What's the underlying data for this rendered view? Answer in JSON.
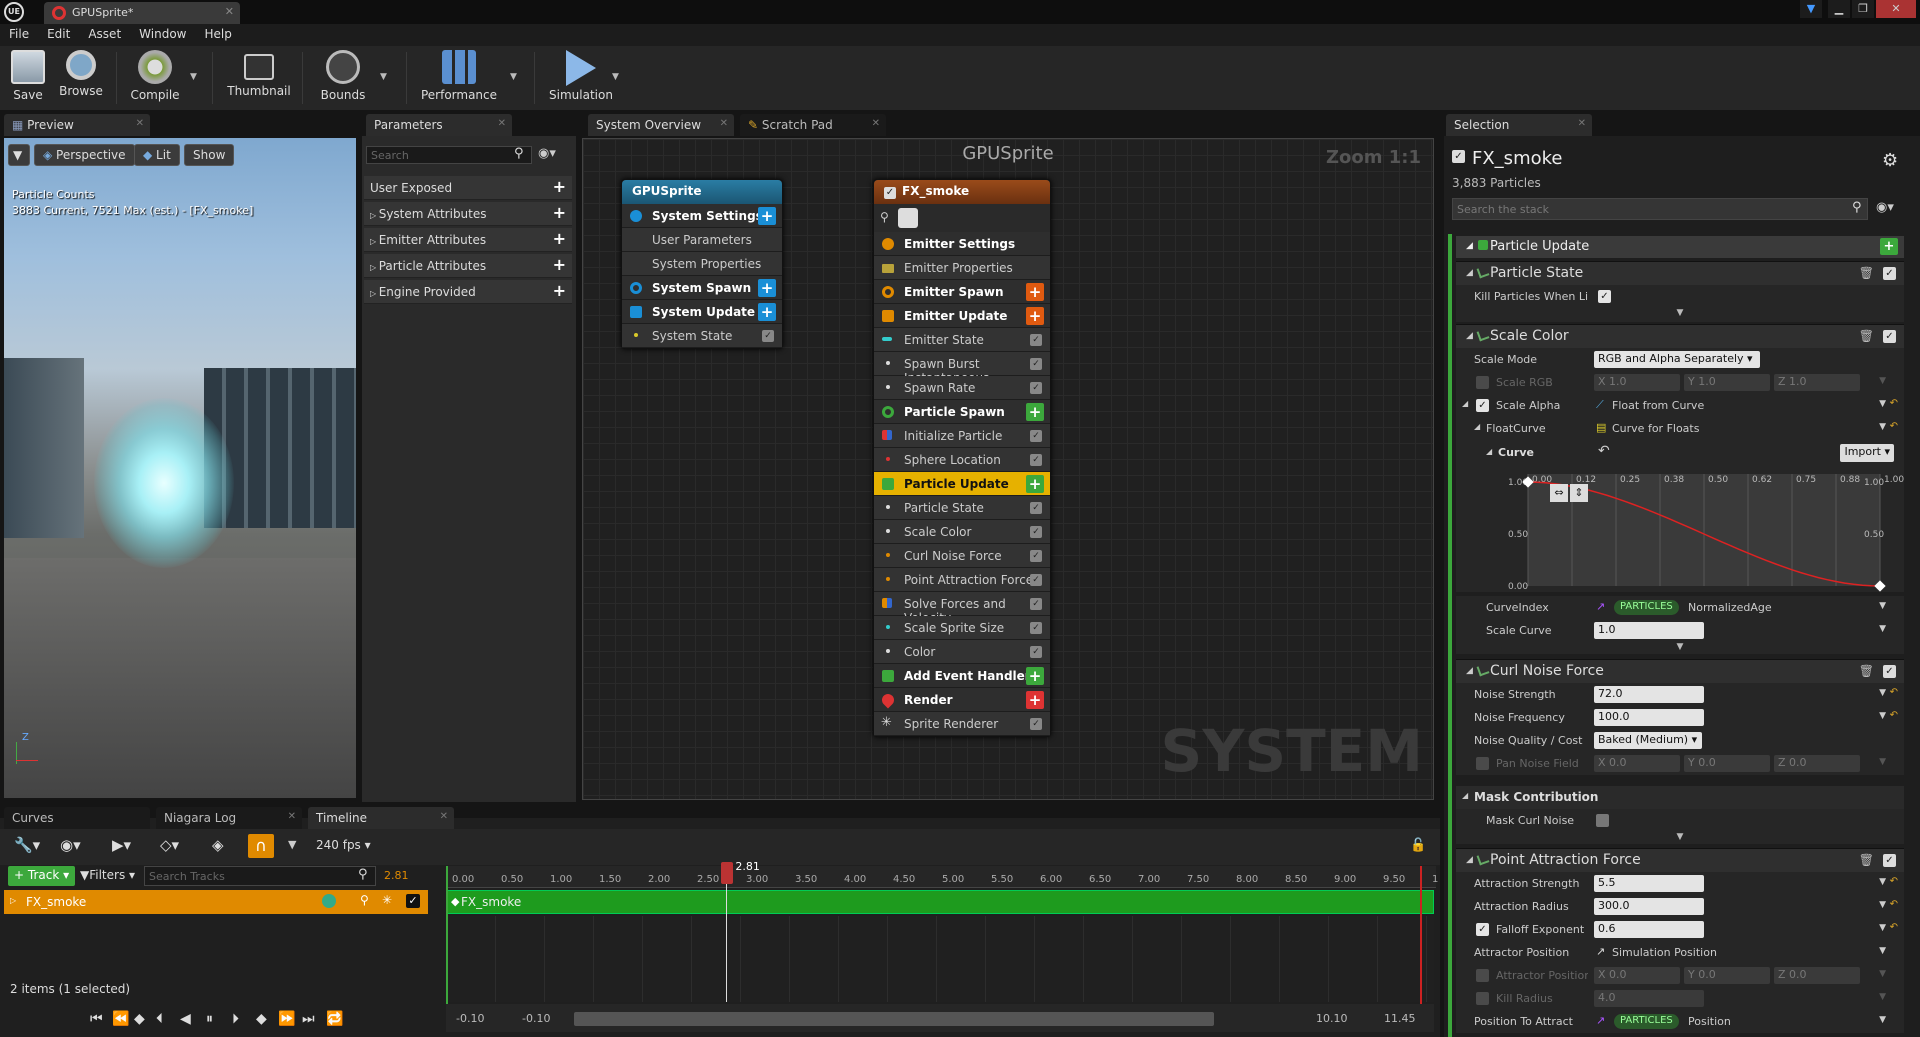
{
  "window": {
    "tab_title": "GPUSprite*",
    "logo": "UE"
  },
  "menu": [
    "File",
    "Edit",
    "Asset",
    "Window",
    "Help"
  ],
  "toolbar": {
    "save": "Save",
    "browse": "Browse",
    "compile": "Compile",
    "thumbnail": "Thumbnail",
    "bounds": "Bounds",
    "performance": "Performance",
    "simulation": "Simulation"
  },
  "preview": {
    "tab": "Preview",
    "perspective": "Perspective",
    "lit": "Lit",
    "show": "Show",
    "counts_title": "Particle Counts",
    "counts_line": "3883 Current, 7521 Max (est.) - [FX_smoke]",
    "axis_z": "Z"
  },
  "parameters": {
    "tab": "Parameters",
    "search_placeholder": "Search",
    "items": [
      "User Exposed",
      "System Attributes",
      "Emitter Attributes",
      "Particle Attributes",
      "Engine Provided"
    ]
  },
  "graph": {
    "tab_overview": "System Overview",
    "tab_scratch": "Scratch Pad",
    "title": "GPUSprite",
    "zoom": "Zoom 1:1",
    "watermark": "SYSTEM",
    "system_node": {
      "title": "GPUSprite",
      "rows": [
        "System Settings",
        "User Parameters",
        "System Properties",
        "System Spawn",
        "System Update",
        "System State"
      ]
    },
    "emitter_node": {
      "title": "FX_smoke",
      "rows": [
        "Emitter Settings",
        "Emitter Properties",
        "Emitter Spawn",
        "Emitter Update",
        "Emitter State",
        "Spawn Burst Instantaneous",
        "Spawn Rate",
        "Particle Spawn",
        "Initialize Particle",
        "Sphere Location",
        "Particle Update",
        "Particle State",
        "Scale Color",
        "Curl Noise Force",
        "Point Attraction Force",
        "Solve Forces and Velocity",
        "Scale Sprite Size",
        "Color",
        "Add Event Handler",
        "Render",
        "Sprite Renderer"
      ]
    }
  },
  "selection": {
    "tab": "Selection",
    "title": "FX_smoke",
    "particles": "3,883 Particles",
    "search_placeholder": "Search the stack",
    "group": "Particle Update",
    "particle_state": {
      "title": "Particle State",
      "kill_label": "Kill Particles When Li"
    },
    "scale_color": {
      "title": "Scale Color",
      "scale_mode_label": "Scale Mode",
      "scale_mode_value": "RGB and Alpha Separately",
      "scale_rgb_label": "Scale RGB",
      "x": "X 1.0",
      "y": "Y 1.0",
      "z": "Z 1.0",
      "scale_alpha_label": "Scale Alpha",
      "scale_alpha_value": "Float from Curve",
      "floatcurve_label": "FloatCurve",
      "floatcurve_value": "Curve for Floats",
      "curve_label": "Curve",
      "import": "Import",
      "curve_x_ticks": [
        "0.00",
        "0.12",
        "0.25",
        "0.38",
        "0.50",
        "0.62",
        "0.75",
        "0.88",
        "1.00"
      ],
      "curve_y_ticks": [
        "1.00",
        "0.50",
        "0.00"
      ],
      "curve_right_ticks": [
        "1.00",
        "0.50"
      ],
      "curveindex_label": "CurveIndex",
      "curveindex_pill": "PARTICLES",
      "curveindex_value": "NormalizedAge",
      "scale_curve_label": "Scale Curve",
      "scale_curve_value": "1.0"
    },
    "curl_noise": {
      "title": "Curl Noise Force",
      "strength_label": "Noise Strength",
      "strength_value": "72.0",
      "frequency_label": "Noise Frequency",
      "frequency_value": "100.0",
      "quality_label": "Noise Quality / Cost",
      "quality_value": "Baked (Medium)",
      "pan_label": "Pan Noise Field",
      "pan_x": "X 0.0",
      "pan_y": "Y 0.0",
      "pan_z": "Z 0.0",
      "mask_title": "Mask Contribution",
      "mask_label": "Mask Curl Noise"
    },
    "point_attraction": {
      "title": "Point Attraction Force",
      "strength_label": "Attraction Strength",
      "strength_value": "5.5",
      "radius_label": "Attraction Radius",
      "radius_value": "300.0",
      "falloff_label": "Falloff Exponent",
      "falloff_value": "0.6",
      "attractor_label": "Attractor Position",
      "attractor_value": "Simulation Position",
      "attractor_pos_label": "Attractor Position",
      "ax": "X 0.0",
      "ay": "Y 0.0",
      "az": "Z 0.0",
      "kill_label": "Kill Radius",
      "kill_value": "4.0",
      "pos_attract_label": "Position To Attract",
      "pos_attract_pill": "PARTICLES",
      "pos_attract_value": "Position"
    }
  },
  "bottom": {
    "tabs": [
      "Curves",
      "Niagara Log",
      "Timeline"
    ],
    "fps": "240 fps",
    "track_btn": "Track",
    "filters_btn": "Filters",
    "search_placeholder": "Search Tracks",
    "current_time": "2.81",
    "row_label": "FX_smoke",
    "items_status": "2 items (1 selected)",
    "ruler_ticks": [
      "0.00",
      "0.50",
      "1.00",
      "1.50",
      "2.00",
      "2.50",
      "3.00",
      "3.50",
      "4.00",
      "4.50",
      "5.00",
      "5.50",
      "6.00",
      "6.50",
      "7.00",
      "7.50",
      "8.00",
      "8.50",
      "9.00",
      "9.50",
      "1"
    ],
    "range_start_a": "-0.10",
    "range_start_b": "-0.10",
    "range_end_a": "10.10",
    "range_end_b": "11.45"
  },
  "colors": {
    "accent_orange": "#e08a00",
    "accent_green": "#3ca83c",
    "accent_blue": "#1a8fd6",
    "highlight_yellow": "#e6b100"
  }
}
